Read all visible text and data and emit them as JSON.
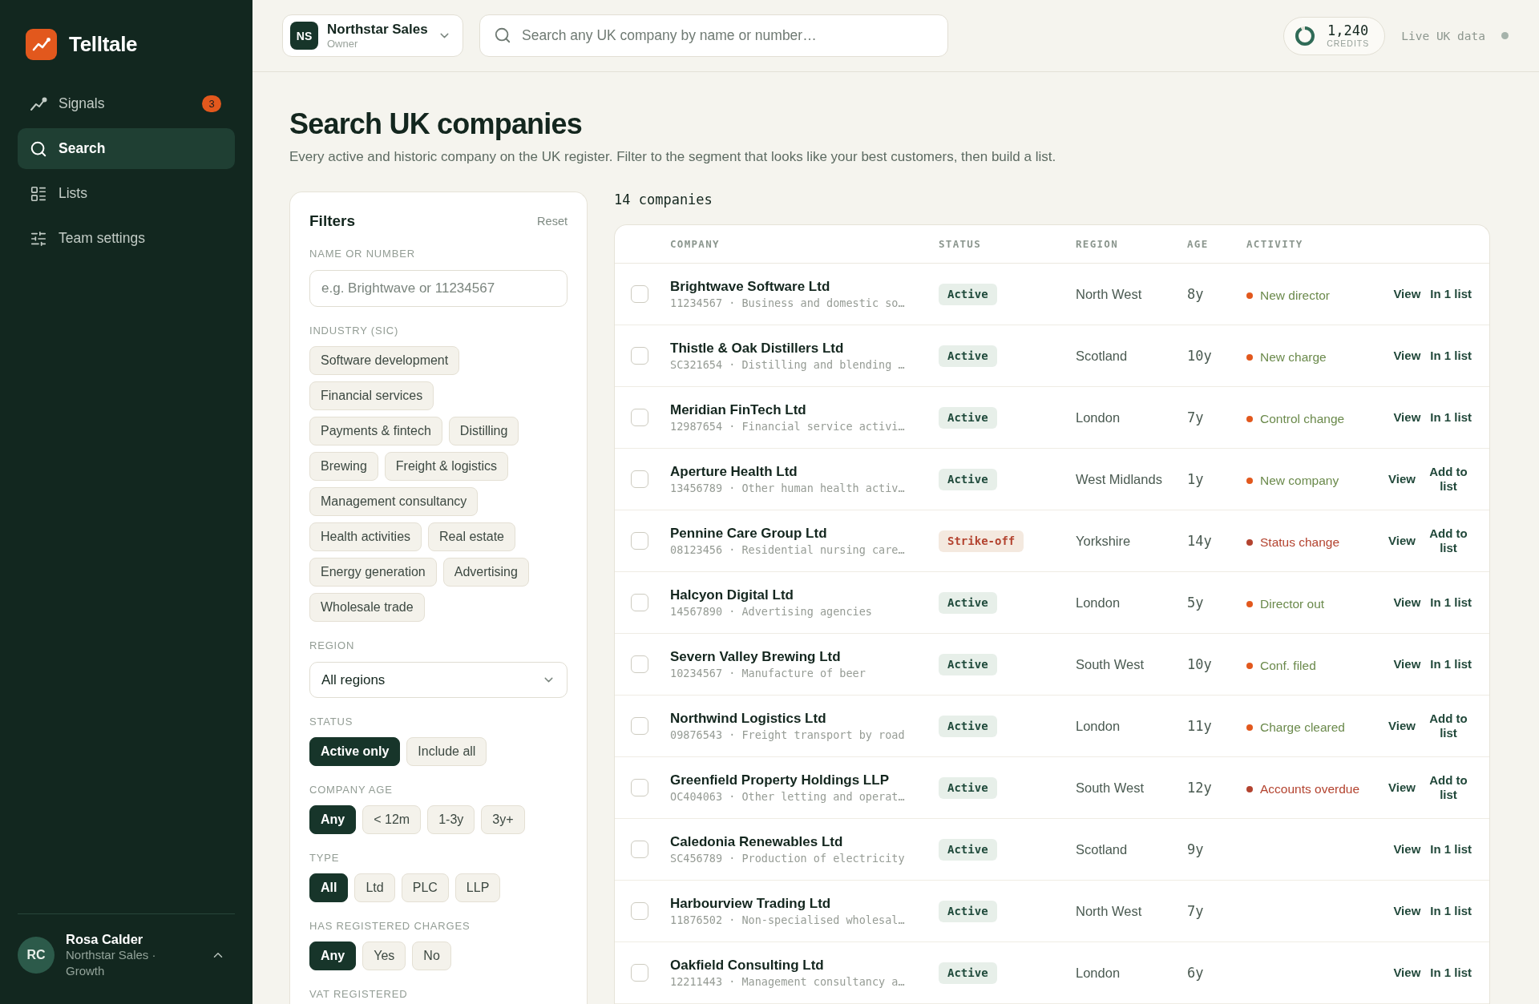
{
  "sidebar": {
    "brand": "Telltale",
    "nav": [
      {
        "label": "Signals",
        "selected": false,
        "badge": "3"
      },
      {
        "label": "Search",
        "selected": true
      },
      {
        "label": "Lists",
        "selected": false
      },
      {
        "label": "Team settings",
        "selected": false
      }
    ],
    "user": {
      "initials": "RC",
      "name": "Rosa Calder",
      "org": "Northstar Sales · Growth"
    }
  },
  "topbar": {
    "org": {
      "initials": "NS",
      "name": "Northstar Sales",
      "role": "Owner"
    },
    "search": {
      "placeholder": "Search any UK company by name or number…"
    },
    "credits": {
      "value": "1,240",
      "label": "CREDITS"
    },
    "live_status": "Live UK data"
  },
  "page": {
    "title": "Search UK companies",
    "subtitle": "Every active and historic company on the UK register. Filter to the segment that looks like your best customers, then build a list."
  },
  "filters": {
    "title": "Filters",
    "reset": "Reset",
    "sections": [
      {
        "kind": "text",
        "label": "NAME OR NUMBER",
        "placeholder": "e.g. Brightwave or 11234567"
      },
      {
        "kind": "chips",
        "label": "INDUSTRY (SIC)",
        "options": [
          {
            "label": "Software development",
            "selected": false
          },
          {
            "label": "Financial services",
            "selected": false
          },
          {
            "label": "Payments & fintech",
            "selected": false
          },
          {
            "label": "Distilling",
            "selected": false
          },
          {
            "label": "Brewing",
            "selected": false
          },
          {
            "label": "Freight & logistics",
            "selected": false
          },
          {
            "label": "Management consultancy",
            "selected": false
          },
          {
            "label": "Health activities",
            "selected": false
          },
          {
            "label": "Real estate",
            "selected": false
          },
          {
            "label": "Energy generation",
            "selected": false
          },
          {
            "label": "Advertising",
            "selected": false
          },
          {
            "label": "Wholesale trade",
            "selected": false
          }
        ]
      },
      {
        "kind": "select",
        "label": "REGION",
        "value": "All regions"
      },
      {
        "kind": "chips",
        "label": "STATUS",
        "options": [
          {
            "label": "Active only",
            "selected": true
          },
          {
            "label": "Include all",
            "selected": false
          }
        ]
      },
      {
        "kind": "chips",
        "label": "COMPANY AGE",
        "options": [
          {
            "label": "Any",
            "selected": true
          },
          {
            "label": "< 12m",
            "selected": false
          },
          {
            "label": "1-3y",
            "selected": false
          },
          {
            "label": "3y+",
            "selected": false
          }
        ]
      },
      {
        "kind": "chips",
        "label": "TYPE",
        "options": [
          {
            "label": "All",
            "selected": true
          },
          {
            "label": "Ltd",
            "selected": false
          },
          {
            "label": "PLC",
            "selected": false
          },
          {
            "label": "LLP",
            "selected": false
          }
        ]
      },
      {
        "kind": "chips",
        "label": "HAS REGISTERED CHARGES",
        "options": [
          {
            "label": "Any",
            "selected": true
          },
          {
            "label": "Yes",
            "selected": false
          },
          {
            "label": "No",
            "selected": false
          }
        ]
      },
      {
        "kind": "chips",
        "label": "VAT REGISTERED"
      }
    ]
  },
  "results": {
    "count": "14 companies",
    "columns": [
      "COMPANY",
      "STATUS",
      "REGION",
      "AGE",
      "ACTIVITY"
    ],
    "rows": [
      {
        "checked": false,
        "name": "Brightwave Software Ltd",
        "meta": "11234567 · Business and domestic so…",
        "status": {
          "label": "Active",
          "kind": "active"
        },
        "region": "North West",
        "age": "8y",
        "activity": {
          "label": "New director",
          "color": "#e2581d",
          "alert": false
        },
        "actions": [
          "View",
          "In 1 list"
        ]
      },
      {
        "checked": false,
        "name": "Thistle & Oak Distillers Ltd",
        "meta": "SC321654 · Distilling and blending …",
        "status": {
          "label": "Active",
          "kind": "active"
        },
        "region": "Scotland",
        "age": "10y",
        "activity": {
          "label": "New charge",
          "color": "#e2581d",
          "alert": false
        },
        "actions": [
          "View",
          "In 1 list"
        ]
      },
      {
        "checked": false,
        "name": "Meridian FinTech Ltd",
        "meta": "12987654 · Financial service activi…",
        "status": {
          "label": "Active",
          "kind": "active"
        },
        "region": "London",
        "age": "7y",
        "activity": {
          "label": "Control change",
          "color": "#e2581d",
          "alert": false
        },
        "actions": [
          "View",
          "In 1 list"
        ]
      },
      {
        "checked": false,
        "name": "Aperture Health Ltd",
        "meta": "13456789 · Other human health activ…",
        "status": {
          "label": "Active",
          "kind": "active"
        },
        "region": "West Midlands",
        "age": "1y",
        "activity": {
          "label": "New company",
          "color": "#e2581d",
          "alert": false
        },
        "actions": [
          "View",
          "Add to list"
        ]
      },
      {
        "checked": false,
        "name": "Pennine Care Group Ltd",
        "meta": "08123456 · Residential nursing care…",
        "status": {
          "label": "Strike-off",
          "kind": "strike-off"
        },
        "region": "Yorkshire",
        "age": "14y",
        "activity": {
          "label": "Status change",
          "color": "#b3432f",
          "alert": true
        },
        "actions": [
          "View",
          "Add to list"
        ]
      },
      {
        "checked": false,
        "name": "Halcyon Digital Ltd",
        "meta": "14567890 · Advertising agencies",
        "status": {
          "label": "Active",
          "kind": "active"
        },
        "region": "London",
        "age": "5y",
        "activity": {
          "label": "Director out",
          "color": "#e2581d",
          "alert": false
        },
        "actions": [
          "View",
          "In 1 list"
        ]
      },
      {
        "checked": false,
        "name": "Severn Valley Brewing Ltd",
        "meta": "10234567 · Manufacture of beer",
        "status": {
          "label": "Active",
          "kind": "active"
        },
        "region": "South West",
        "age": "10y",
        "activity": {
          "label": "Conf. filed",
          "color": "#e2581d",
          "alert": false
        },
        "actions": [
          "View",
          "In 1 list"
        ]
      },
      {
        "checked": false,
        "name": "Northwind Logistics Ltd",
        "meta": "09876543 · Freight transport by road",
        "status": {
          "label": "Active",
          "kind": "active"
        },
        "region": "London",
        "age": "11y",
        "activity": {
          "label": "Charge cleared",
          "color": "#e2581d",
          "alert": false
        },
        "actions": [
          "View",
          "Add to list"
        ]
      },
      {
        "checked": false,
        "name": "Greenfield Property Holdings LLP",
        "meta": "OC404063 · Other letting and operat…",
        "status": {
          "label": "Active",
          "kind": "active"
        },
        "region": "South West",
        "age": "12y",
        "activity": {
          "label": "Accounts overdue",
          "color": "#b3432f",
          "alert": true
        },
        "actions": [
          "View",
          "Add to list"
        ]
      },
      {
        "checked": false,
        "name": "Caledonia Renewables Ltd",
        "meta": "SC456789 · Production of electricity",
        "status": {
          "label": "Active",
          "kind": "active"
        },
        "region": "Scotland",
        "age": "9y",
        "actions": [
          "View",
          "In 1 list"
        ]
      },
      {
        "checked": false,
        "name": "Harbourview Trading Ltd",
        "meta": "11876502 · Non-specialised wholesal…",
        "status": {
          "label": "Active",
          "kind": "active"
        },
        "region": "North West",
        "age": "7y",
        "actions": [
          "View",
          "In 1 list"
        ]
      },
      {
        "checked": false,
        "name": "Oakfield Consulting Ltd",
        "meta": "12211443 · Management consultancy a…",
        "status": {
          "label": "Active",
          "kind": "active"
        },
        "region": "London",
        "age": "6y",
        "actions": [
          "View",
          "In 1 list"
        ]
      }
    ]
  }
}
